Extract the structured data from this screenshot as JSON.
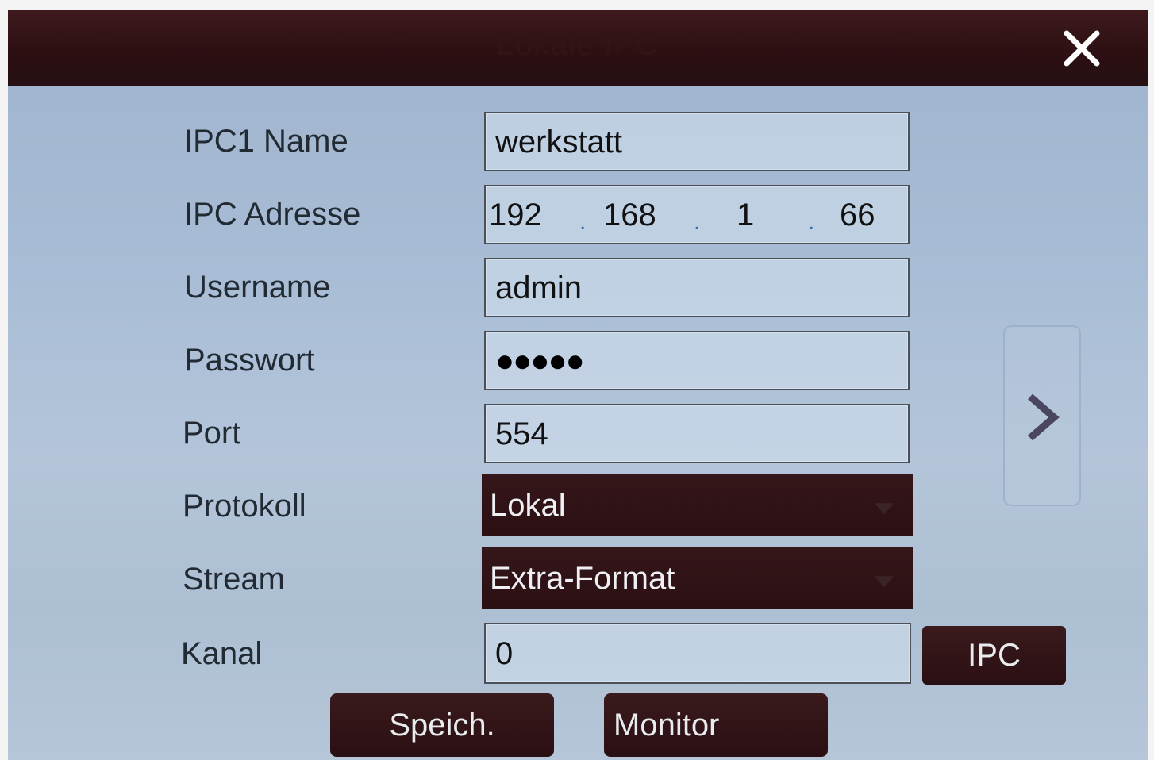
{
  "dialog": {
    "title": "Lokale IPC",
    "close_icon": "close-icon"
  },
  "form": {
    "name": {
      "label": "IPC1 Name",
      "value": "werkstatt"
    },
    "address": {
      "label": "IPC Adresse",
      "octets": [
        "192",
        "168",
        "1",
        "66"
      ],
      "separator": "."
    },
    "username": {
      "label": "Username",
      "value": "admin"
    },
    "password": {
      "label": "Passwort",
      "masked_value": "●●●●●"
    },
    "port": {
      "label": "Port",
      "value": "554"
    },
    "protocol": {
      "label": "Protokoll",
      "selected": "Lokal"
    },
    "stream": {
      "label": "Stream",
      "selected": "Extra-Format"
    },
    "channel": {
      "label": "Kanal",
      "value": "0"
    }
  },
  "buttons": {
    "ipc": "IPC",
    "save": "Speich.",
    "monitor": "Monitor"
  },
  "navigation": {
    "next_icon": "chevron-right-icon"
  },
  "colors": {
    "title_bar": "#2c0f12",
    "dropdown_bg": "#2b0f12",
    "background": "#a8bdd5"
  }
}
